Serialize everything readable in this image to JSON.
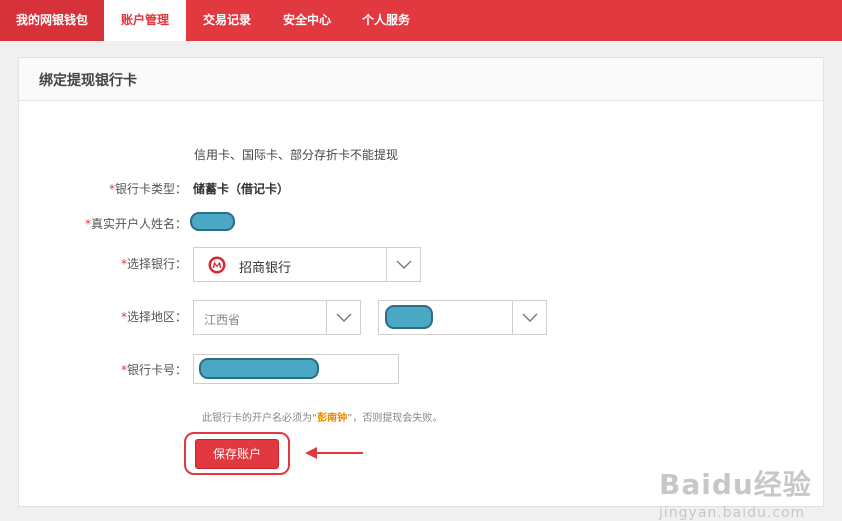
{
  "nav": {
    "items": [
      {
        "label": "我的网银钱包"
      },
      {
        "label": "账户管理"
      },
      {
        "label": "交易记录"
      },
      {
        "label": "安全中心"
      },
      {
        "label": "个人服务"
      }
    ],
    "active_index": 1
  },
  "panel": {
    "title": "绑定提现银行卡"
  },
  "form": {
    "notice": "信用卡、国际卡、部分存折卡不能提现",
    "required_mark": "*",
    "card_type": {
      "label": "银行卡类型：",
      "value": "储蓄卡（借记卡）"
    },
    "holder_name": {
      "label": "真实开户人姓名："
    },
    "bank": {
      "label": "选择银行：",
      "value": "招商银行",
      "icon": "cmb-bank-logo-icon"
    },
    "region": {
      "label": "选择地区：",
      "province": "江西省"
    },
    "card_number": {
      "label": "银行卡号："
    },
    "hint": {
      "prefix": "此银行卡的开户名必须为“",
      "name": "彭南钟",
      "suffix": "”，否则提现会失败。"
    },
    "save_label": "保存账户"
  },
  "watermark": {
    "logo": "Baidu经验",
    "url": "jingyan.baidu.com"
  },
  "colors": {
    "brand_red": "#e2383f",
    "redaction": "#4aa8c4",
    "hint_highlight": "#f08a00"
  }
}
